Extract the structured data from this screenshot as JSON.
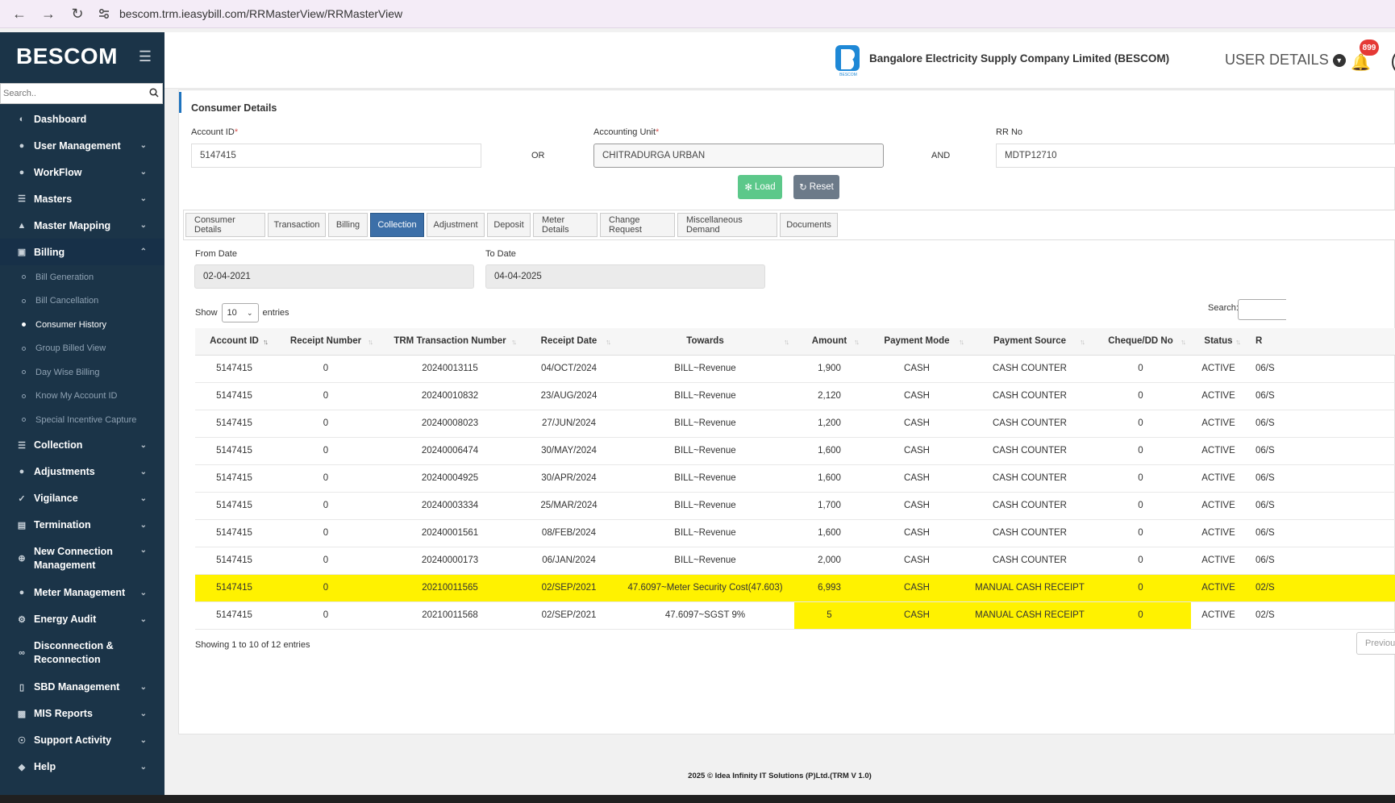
{
  "browser": {
    "url": "bescom.trm.ieasybill.com/RRMasterView/RRMasterView"
  },
  "sidebar": {
    "logo": "BESCOM",
    "search_placeholder": "Search..",
    "menu": [
      {
        "label": "Dashboard",
        "icon": "dashboard-icon"
      },
      {
        "label": "User Management",
        "icon": "user-icon"
      },
      {
        "label": "WorkFlow",
        "icon": "user-icon"
      },
      {
        "label": "Masters",
        "icon": "list-icon"
      },
      {
        "label": "Master Mapping",
        "icon": "sitemap-icon"
      },
      {
        "label": "Billing",
        "icon": "monitor-icon"
      }
    ],
    "billing_sub": [
      "Bill Generation",
      "Bill Cancellation",
      "Consumer History",
      "Group Billed View",
      "Day Wise Billing",
      "Know My Account ID",
      "Special Incentive Capture"
    ],
    "menu_after": [
      {
        "label": "Collection",
        "icon": "list-icon"
      },
      {
        "label": "Adjustments",
        "icon": "users-icon"
      },
      {
        "label": "Vigilance",
        "icon": "vk-icon"
      },
      {
        "label": "Termination",
        "icon": "trash-icon"
      },
      {
        "label": "New Connection Management",
        "icon": "plus-circle-icon"
      },
      {
        "label": "Meter Management",
        "icon": "user-icon"
      },
      {
        "label": "Energy Audit",
        "icon": "cogs-icon"
      },
      {
        "label": "Disconnection & Reconnection",
        "icon": "link-icon"
      },
      {
        "label": "SBD Management",
        "icon": "mobile-icon"
      },
      {
        "label": "MIS Reports",
        "icon": "bar-chart-icon"
      },
      {
        "label": "Support Activity",
        "icon": "headset-icon"
      },
      {
        "label": "Help",
        "icon": "gamepad-icon"
      }
    ]
  },
  "header": {
    "company_logo_text": "BESCOM",
    "company_name": "Bangalore Electricity Supply Company Limited (BESCOM)",
    "user_details": "USER DETAILS",
    "notification_count": "899"
  },
  "consumer": {
    "title": "Consumer Details",
    "account_id_label": "Account ID",
    "account_id": "5147415",
    "or": "OR",
    "accounting_unit_label": "Accounting Unit",
    "accounting_unit": "CHITRADURGA URBAN",
    "and": "AND",
    "rr_no_label": "RR No",
    "rr_no": "MDTP12710",
    "load": "Load",
    "reset": "Reset"
  },
  "tabs": [
    "Consumer Details",
    "Transaction",
    "Billing",
    "Collection",
    "Adjustment",
    "Deposit",
    "Meter Details",
    "Change Request",
    "Miscellaneous Demand",
    "Documents"
  ],
  "filters": {
    "from_label": "From Date",
    "from_value": "02-04-2021",
    "to_label": "To Date",
    "to_value": "04-04-2025",
    "show": "Show",
    "entries_value": "10",
    "entries": "entries",
    "search": "Search:"
  },
  "table": {
    "columns": [
      "Account ID",
      "Receipt Number",
      "TRM Transaction Number",
      "Receipt Date",
      "Towards",
      "Amount",
      "Payment Mode",
      "Payment Source",
      "Cheque/DD No",
      "Status",
      "R"
    ],
    "rows": [
      [
        "5147415",
        "0",
        "20240013115",
        "04/OCT/2024",
        "BILL~Revenue",
        "1,900",
        "CASH",
        "CASH COUNTER",
        "0",
        "ACTIVE",
        "06/S"
      ],
      [
        "5147415",
        "0",
        "20240010832",
        "23/AUG/2024",
        "BILL~Revenue",
        "2,120",
        "CASH",
        "CASH COUNTER",
        "0",
        "ACTIVE",
        "06/S"
      ],
      [
        "5147415",
        "0",
        "20240008023",
        "27/JUN/2024",
        "BILL~Revenue",
        "1,200",
        "CASH",
        "CASH COUNTER",
        "0",
        "ACTIVE",
        "06/S"
      ],
      [
        "5147415",
        "0",
        "20240006474",
        "30/MAY/2024",
        "BILL~Revenue",
        "1,600",
        "CASH",
        "CASH COUNTER",
        "0",
        "ACTIVE",
        "06/S"
      ],
      [
        "5147415",
        "0",
        "20240004925",
        "30/APR/2024",
        "BILL~Revenue",
        "1,600",
        "CASH",
        "CASH COUNTER",
        "0",
        "ACTIVE",
        "06/S"
      ],
      [
        "5147415",
        "0",
        "20240003334",
        "25/MAR/2024",
        "BILL~Revenue",
        "1,700",
        "CASH",
        "CASH COUNTER",
        "0",
        "ACTIVE",
        "06/S"
      ],
      [
        "5147415",
        "0",
        "20240001561",
        "08/FEB/2024",
        "BILL~Revenue",
        "1,600",
        "CASH",
        "CASH COUNTER",
        "0",
        "ACTIVE",
        "06/S"
      ],
      [
        "5147415",
        "0",
        "20240000173",
        "06/JAN/2024",
        "BILL~Revenue",
        "2,000",
        "CASH",
        "CASH COUNTER",
        "0",
        "ACTIVE",
        "06/S"
      ],
      [
        "5147415",
        "0",
        "20210011565",
        "02/SEP/2021",
        "47.6097~Meter Security Cost(47.603)",
        "6,993",
        "CASH",
        "MANUAL CASH RECEIPT",
        "0",
        "ACTIVE",
        "02/S"
      ],
      [
        "5147415",
        "0",
        "20210011568",
        "02/SEP/2021",
        "47.6097~SGST 9%",
        "5",
        "CASH",
        "MANUAL CASH RECEIPT",
        "0",
        "ACTIVE",
        "02/S"
      ]
    ],
    "info": "Showing 1 to 10 of 12 entries",
    "previous": "Previous"
  },
  "footer": "2025 © Idea Infinity IT Solutions (P)Ltd.(TRM V 1.0)",
  "colors": {
    "sidebar_bg": "#1b3448",
    "active_tab": "#3c6fa8",
    "load_btn": "#5cc88a",
    "reset_btn": "#6c7a89",
    "highlight": "#fff200"
  }
}
